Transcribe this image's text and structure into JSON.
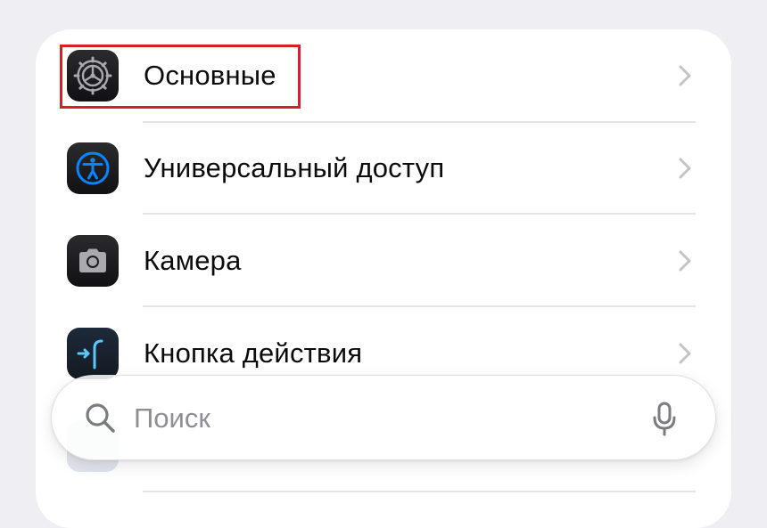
{
  "settings": {
    "items": [
      {
        "label": "Основные",
        "icon": "gear-icon"
      },
      {
        "label": "Универсальный доступ",
        "icon": "accessibility-icon"
      },
      {
        "label": "Камера",
        "icon": "camera-icon"
      },
      {
        "label": "Кнопка действия",
        "icon": "action-button-icon"
      }
    ]
  },
  "search": {
    "placeholder": "Поиск"
  },
  "colors": {
    "accent": "#0a84ff",
    "highlight": "#d5202a",
    "chevron": "#c4c4c8"
  }
}
